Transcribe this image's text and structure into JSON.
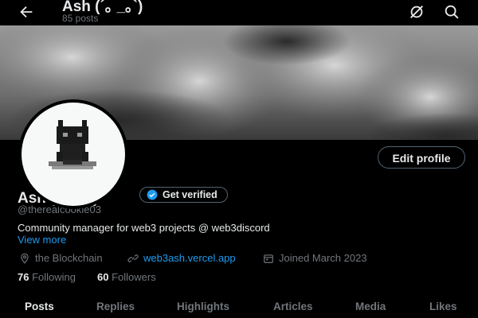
{
  "header": {
    "title": "Ash (´｡ _｡`)",
    "post_count": "85 posts"
  },
  "profile": {
    "edit_label": "Edit profile",
    "name": "Ash (´｡ _｡`)",
    "verify_label": "Get verified",
    "handle": "@therealcookie03",
    "bio": "Community manager for web3 projects @ web3discord",
    "view_more": "View more",
    "location": "the Blockchain",
    "website": "web3ash.vercel.app",
    "joined": "Joined March 2023",
    "following_count": "76",
    "following_label": "Following",
    "followers_count": "60",
    "followers_label": "Followers"
  },
  "tabs": [
    {
      "label": "Posts",
      "active": true
    },
    {
      "label": "Replies",
      "active": false
    },
    {
      "label": "Highlights",
      "active": false
    },
    {
      "label": "Articles",
      "active": false
    },
    {
      "label": "Media",
      "active": false
    },
    {
      "label": "Likes",
      "active": false
    }
  ],
  "icons": {
    "back": "back-arrow-icon",
    "grok": "grok-icon",
    "search": "search-icon",
    "verified": "verified-badge-icon",
    "location": "location-pin-icon",
    "link": "link-icon",
    "calendar": "calendar-icon"
  },
  "colors": {
    "background": "#000000",
    "text_primary": "#e7e9ea",
    "text_secondary": "#71767b",
    "accent": "#1d9bf0"
  }
}
